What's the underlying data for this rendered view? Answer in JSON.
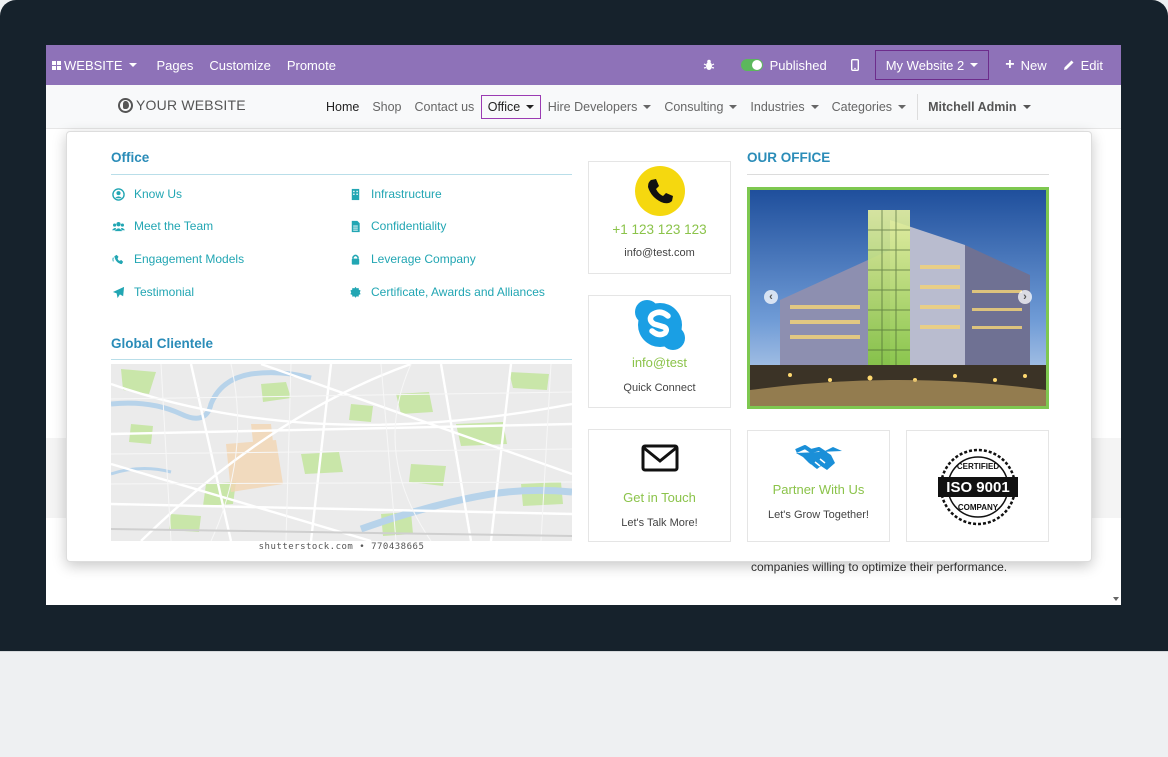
{
  "admin_bar": {
    "website_label": "WEBSITE",
    "pages": "Pages",
    "customize": "Customize",
    "promote": "Promote",
    "published": "Published",
    "site_select": "My Website 2",
    "new": "New",
    "edit": "Edit"
  },
  "header": {
    "logo_text": "YOUR WEBSITE",
    "nav": {
      "home": "Home",
      "shop": "Shop",
      "contact": "Contact us",
      "office": "Office",
      "hire": "Hire Developers",
      "consulting": "Consulting",
      "industries": "Industries",
      "categories": "Categories",
      "user": "Mitchell Admin"
    }
  },
  "mega_menu": {
    "office_title": "Office",
    "links": {
      "know_us": "Know Us",
      "infrastructure": "Infrastructure",
      "meet_team": "Meet the Team",
      "confidentiality": "Confidentiality",
      "engagement": "Engagement Models",
      "leverage": "Leverage Company",
      "testimonial": "Testimonial",
      "certificate": "Certificate, Awards and Alliances"
    },
    "clientele_title": "Global Clientele",
    "map_caption": "shutterstock.com • 770438665",
    "our_office_title": "OUR OFFICE",
    "cards": {
      "phone_title": "+1 123 123 123",
      "phone_sub": "info@test.com",
      "skype_title": "info@test",
      "skype_sub": "Quick Connect",
      "touch_title": "Get in Touch",
      "touch_sub": "Let's Talk More!",
      "partner_title": "Partner With Us",
      "partner_sub": "Let's Grow Together!",
      "iso_top": "CERTIFIED",
      "iso_main": "ISO 9001",
      "iso_bottom": "COMPANY"
    }
  },
  "page_background_text": "companies willing to optimize their performance.",
  "colors": {
    "admin_bar": "#8e72b8",
    "link": "#22a6b3",
    "section_title": "#2a8cb8",
    "card_title": "#8bc34a"
  }
}
